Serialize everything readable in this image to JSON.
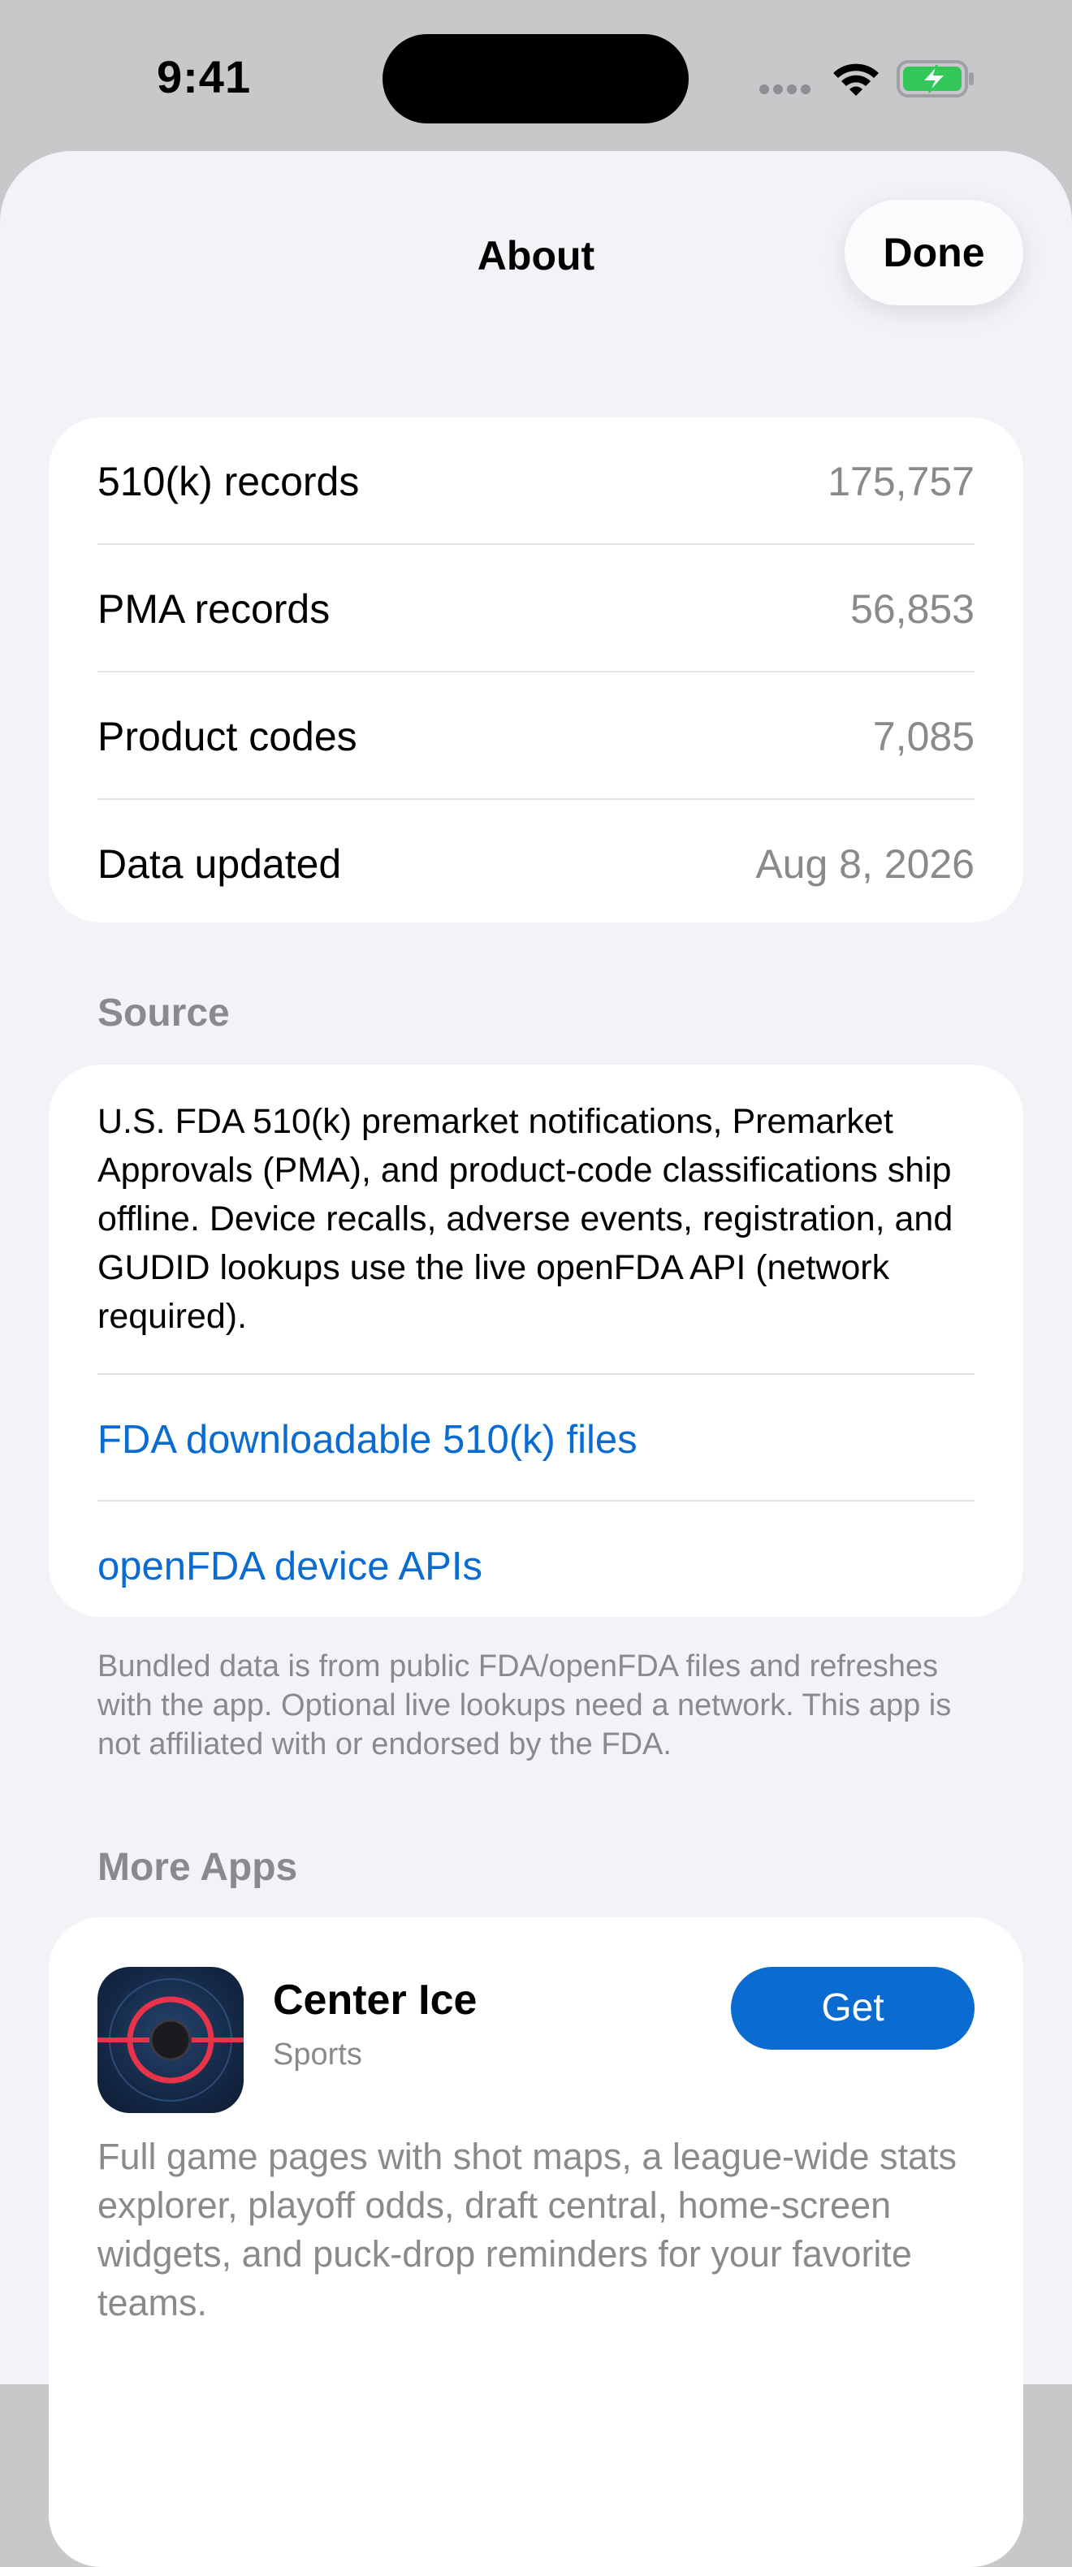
{
  "status_bar": {
    "time": "9:41"
  },
  "nav": {
    "title": "About",
    "done_label": "Done"
  },
  "stats": [
    {
      "label": "510(k) records",
      "value": "175,757"
    },
    {
      "label": "PMA records",
      "value": "56,853"
    },
    {
      "label": "Product codes",
      "value": "7,085"
    },
    {
      "label": "Data updated",
      "value": "Aug 8, 2026"
    }
  ],
  "source": {
    "header": "Source",
    "description": "U.S. FDA 510(k) premarket notifications, Premarket Approvals (PMA), and product-code classifications ship offline. Device recalls, adverse events, registration, and GUDID lookups use the live openFDA API (network required).",
    "links": [
      {
        "label": "FDA downloadable 510(k) files"
      },
      {
        "label": "openFDA device APIs"
      }
    ],
    "footnote": "Bundled data is from public FDA/openFDA files and refreshes with the app. Optional live lookups need a network. This app is not affiliated with or endorsed by the FDA."
  },
  "more_apps": {
    "header": "More Apps",
    "apps": [
      {
        "name": "Center Ice",
        "category": "Sports",
        "get_label": "Get",
        "description": "Full game pages with shot maps, a league-wide stats explorer, playoff odds, draft central, home-screen widgets, and puck-drop reminders for your favorite teams."
      }
    ]
  },
  "colors": {
    "accent": "#0a6bd1",
    "secondary_text": "#8a8a8e",
    "background": "#f2f2f7"
  }
}
